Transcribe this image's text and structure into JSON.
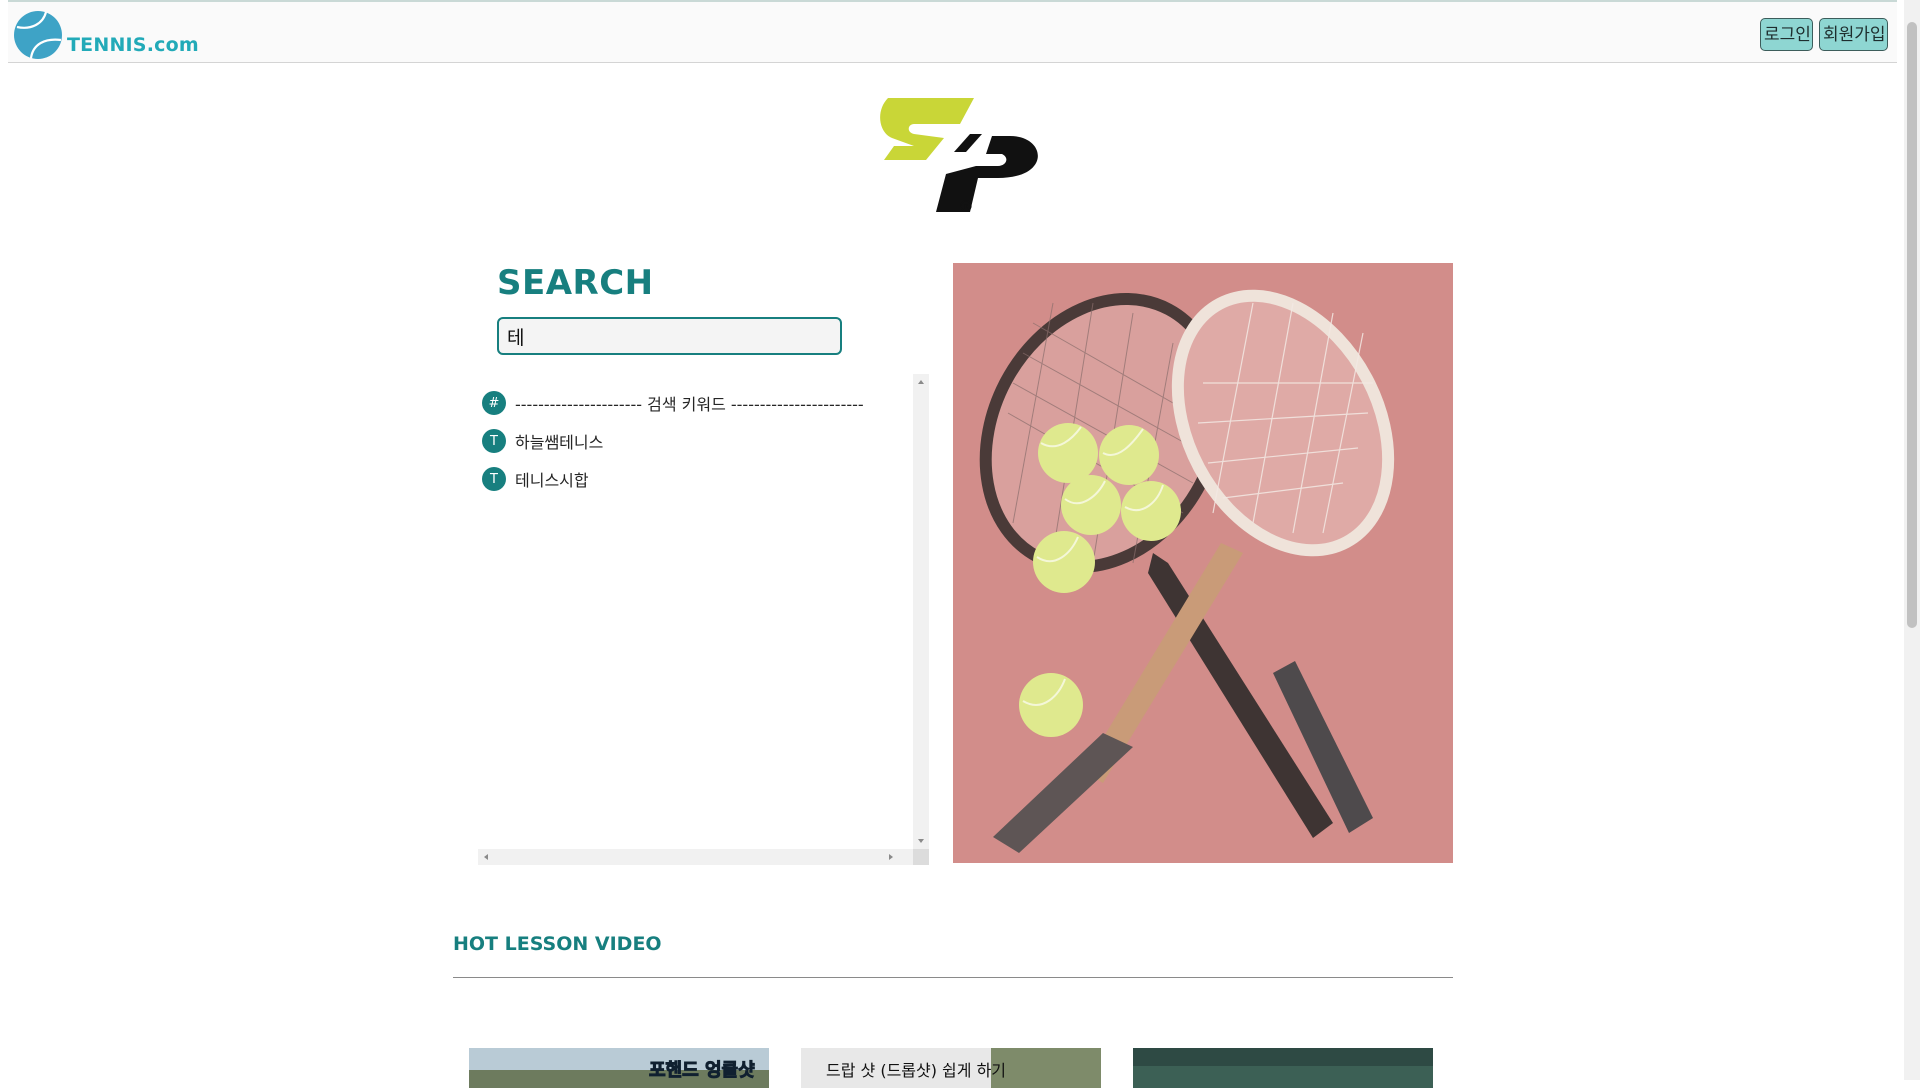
{
  "header": {
    "brand_name": "TENNIS.com",
    "login_label": "로그인",
    "signup_label": "회원가입"
  },
  "search": {
    "title": "SEARCH",
    "value": "테"
  },
  "suggestions": [
    {
      "icon": "#",
      "text": "---------------------- 검색 키워드 -----------------------"
    },
    {
      "icon": "T",
      "text": "하늘쌤테니스"
    },
    {
      "icon": "T",
      "text": "테니스시합"
    }
  ],
  "hot_lesson": {
    "title": "HOT LESSON VIDEO",
    "videos": [
      {
        "caption": "포핸드 엉클샷"
      },
      {
        "caption": "드랍 샷 (드롭샷) 쉽게 하기"
      },
      {
        "caption": ""
      }
    ]
  },
  "colors": {
    "accent": "#177f7f",
    "brand": "#22aab8",
    "button_bg": "#8ed6d2",
    "logo_green": "#c9d637",
    "hero_bg": "#d28d8a"
  }
}
